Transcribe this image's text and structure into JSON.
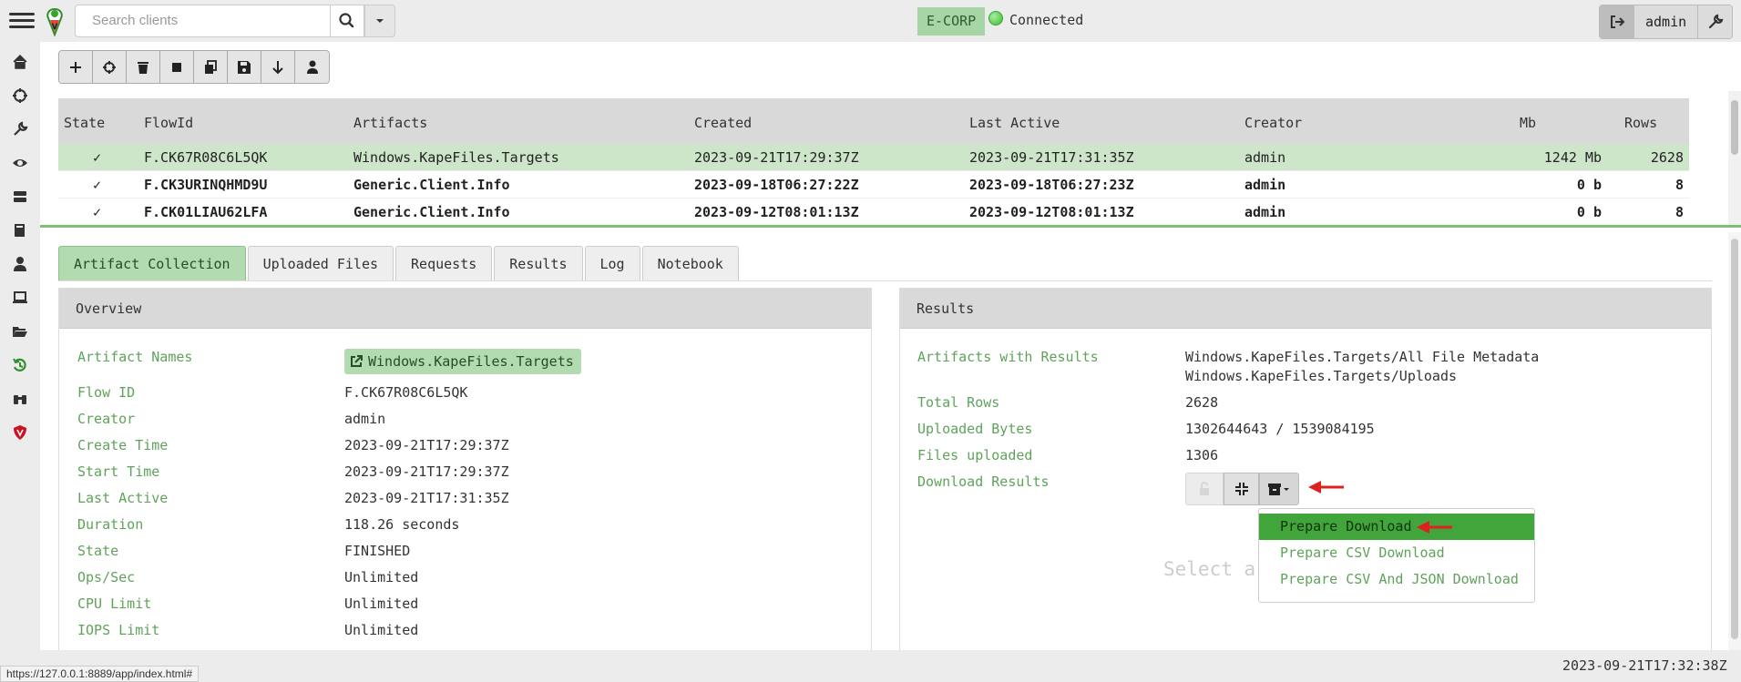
{
  "search": {
    "placeholder": "Search clients"
  },
  "org": {
    "name": "E-CORP",
    "status": "Connected"
  },
  "user": {
    "name": "admin"
  },
  "flows": {
    "columns": [
      "State",
      "FlowId",
      "Artifacts",
      "Created",
      "Last Active",
      "Creator",
      "Mb",
      "Rows"
    ],
    "rows": [
      {
        "state": "✓",
        "flow_id": "F.CK67R08C6L5QK",
        "artifacts": "Windows.KapeFiles.Targets",
        "created": "2023-09-21T17:29:37Z",
        "last_active": "2023-09-21T17:31:35Z",
        "creator": "admin",
        "mb": "1242 Mb",
        "rows": "2628"
      },
      {
        "state": "✓",
        "flow_id": "F.CK3URINQHMD9U",
        "artifacts": "Generic.Client.Info",
        "created": "2023-09-18T06:27:22Z",
        "last_active": "2023-09-18T06:27:23Z",
        "creator": "admin",
        "mb": "0 b",
        "rows": "8"
      },
      {
        "state": "✓",
        "flow_id": "F.CK01LIAU62LFA",
        "artifacts": "Generic.Client.Info",
        "created": "2023-09-12T08:01:13Z",
        "last_active": "2023-09-12T08:01:13Z",
        "creator": "admin",
        "mb": "0 b",
        "rows": "8"
      }
    ]
  },
  "tabs": [
    "Artifact Collection",
    "Uploaded Files",
    "Requests",
    "Results",
    "Log",
    "Notebook"
  ],
  "overview": {
    "title": "Overview",
    "artifact_names_label": "Artifact Names",
    "artifact_names_value": "Windows.KapeFiles.Targets",
    "fields": [
      {
        "label": "Flow ID",
        "value": "F.CK67R08C6L5QK"
      },
      {
        "label": "Creator",
        "value": "admin"
      },
      {
        "label": "Create Time",
        "value": "2023-09-21T17:29:37Z"
      },
      {
        "label": "Start Time",
        "value": "2023-09-21T17:29:37Z"
      },
      {
        "label": "Last Active",
        "value": "2023-09-21T17:31:35Z"
      },
      {
        "label": "Duration",
        "value": "118.26 seconds"
      },
      {
        "label": "State",
        "value": "FINISHED"
      },
      {
        "label": "Ops/Sec",
        "value": "Unlimited"
      },
      {
        "label": "CPU Limit",
        "value": "Unlimited"
      },
      {
        "label": "IOPS Limit",
        "value": "Unlimited"
      }
    ]
  },
  "results": {
    "title": "Results",
    "artifacts_label": "Artifacts with Results",
    "artifacts_values": [
      "Windows.KapeFiles.Targets/All File Metadata",
      "Windows.KapeFiles.Targets/Uploads"
    ],
    "fields": [
      {
        "label": "Total Rows",
        "value": "2628"
      },
      {
        "label": "Uploaded Bytes",
        "value": "1302644643 / 1539084195"
      },
      {
        "label": "Files uploaded",
        "value": "1306"
      }
    ],
    "download_label": "Download Results",
    "dropdown": [
      "Prepare Download",
      "Prepare CSV Download",
      "Prepare CSV And JSON Download"
    ],
    "select_hint": "Select a"
  },
  "status": {
    "url": "https://127.0.0.1:8889/app/index.html#",
    "time": "2023-09-21T17:32:38Z"
  },
  "colors": {
    "accent": "#41a53b",
    "selected_row": "#cde6ca",
    "annotation_arrow": "#e02020"
  }
}
